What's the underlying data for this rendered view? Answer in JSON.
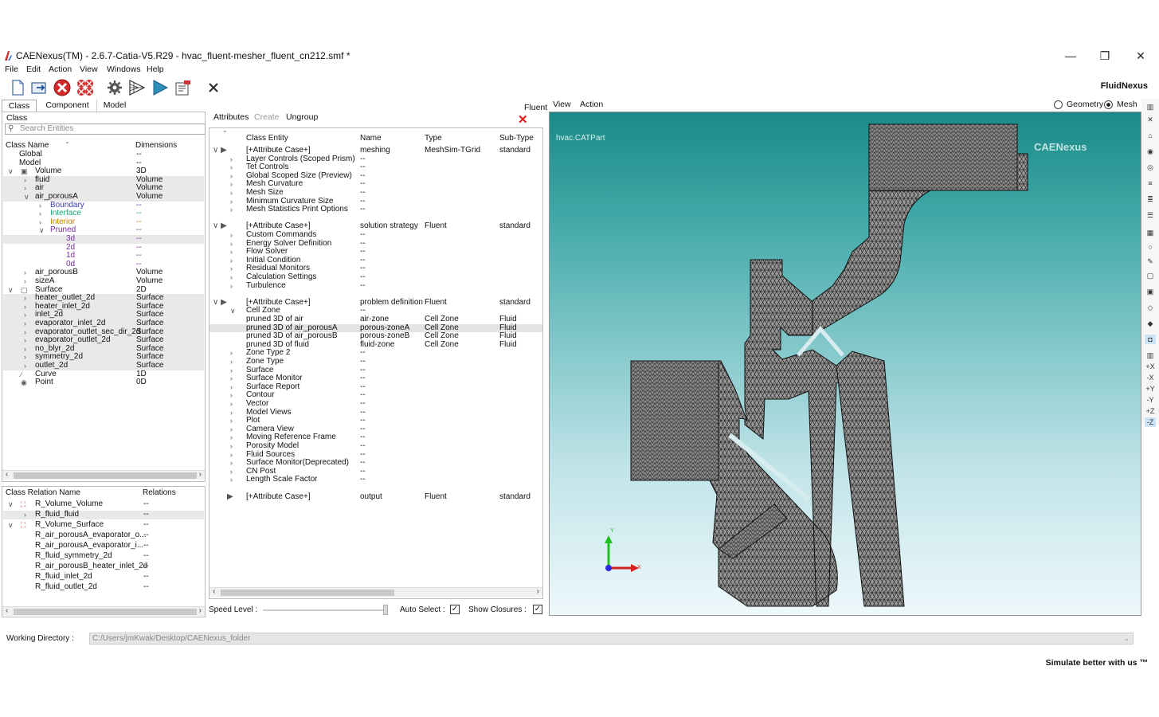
{
  "window": {
    "title": "CAENexus(TM) - 2.6.7-Catia-V5.R29 - hvac_fluent-mesher_fluent_cn212.smf  *",
    "minimize": "—",
    "restore": "❐",
    "close": "✕"
  },
  "menu": [
    "File",
    "Edit",
    "Action",
    "View",
    "Windows",
    "Help"
  ],
  "toolbar": {
    "brand": "FluidNexus"
  },
  "left_tabs": [
    "Class",
    "Component",
    "Model"
  ],
  "class_panel": {
    "section": "Class",
    "search_placeholder": "Search Entities",
    "col_name": "Class Name",
    "col_dim": "Dimensions",
    "rows": [
      {
        "chev": "",
        "name": "Global",
        "dim": "--",
        "indent": 20,
        "color": "#111",
        "shade": false
      },
      {
        "chev": "",
        "name": "Model",
        "dim": "--",
        "indent": 20,
        "color": "#111",
        "shade": false
      },
      {
        "chev": "∨",
        "name": "Volume",
        "dim": "3D",
        "indent": 40,
        "color": "#111",
        "shade": false,
        "icon": "cube"
      },
      {
        "chev": "›",
        "name": "fluid",
        "dim": "Volume",
        "indent": 40,
        "color": "#111",
        "shade": true
      },
      {
        "chev": "›",
        "name": "air",
        "dim": "Volume",
        "indent": 40,
        "color": "#111",
        "shade": true
      },
      {
        "chev": "∨",
        "name": "air_porousA",
        "dim": "Volume",
        "indent": 40,
        "color": "#111",
        "shade": true
      },
      {
        "chev": "›",
        "name": "Boundary",
        "dim": "--",
        "indent": 59,
        "color": "#3a3ab0",
        "shade": false
      },
      {
        "chev": "›",
        "name": "Interface",
        "dim": "--",
        "indent": 59,
        "color": "#1aa37a",
        "shade": false
      },
      {
        "chev": "›",
        "name": "Interior",
        "dim": "--",
        "indent": 59,
        "color": "#c87a00",
        "shade": false
      },
      {
        "chev": "∨",
        "name": "Pruned",
        "dim": "--",
        "indent": 59,
        "color": "#7a2aa0",
        "shade": false
      },
      {
        "chev": "",
        "name": "3d",
        "dim": "--",
        "indent": 79,
        "color": "#7a2aa0",
        "shade": true
      },
      {
        "chev": "",
        "name": "2d",
        "dim": "--",
        "indent": 79,
        "color": "#7a2aa0",
        "shade": false
      },
      {
        "chev": "",
        "name": "1d",
        "dim": "--",
        "indent": 79,
        "color": "#7a2aa0",
        "shade": false
      },
      {
        "chev": "",
        "name": "0d",
        "dim": "--",
        "indent": 79,
        "color": "#7a2aa0",
        "shade": false
      },
      {
        "chev": "›",
        "name": "air_porousB",
        "dim": "Volume",
        "indent": 40,
        "color": "#111",
        "shade": false
      },
      {
        "chev": "›",
        "name": "sizeA",
        "dim": "Volume",
        "indent": 40,
        "color": "#111",
        "shade": false
      },
      {
        "chev": "∨",
        "name": "Surface",
        "dim": "2D",
        "indent": 40,
        "color": "#111",
        "shade": false,
        "icon": "square"
      },
      {
        "chev": "›",
        "name": "heater_outlet_2d",
        "dim": "Surface",
        "indent": 40,
        "color": "#111",
        "shade": true
      },
      {
        "chev": "›",
        "name": "heater_inlet_2d",
        "dim": "Surface",
        "indent": 40,
        "color": "#111",
        "shade": true
      },
      {
        "chev": "›",
        "name": "inlet_2d",
        "dim": "Surface",
        "indent": 40,
        "color": "#111",
        "shade": true
      },
      {
        "chev": "›",
        "name": "evaporator_inlet_2d",
        "dim": "Surface",
        "indent": 40,
        "color": "#111",
        "shade": true
      },
      {
        "chev": "›",
        "name": "evaporator_outlet_sec_dir_2d",
        "dim": "Surface",
        "indent": 40,
        "color": "#111",
        "shade": true
      },
      {
        "chev": "›",
        "name": "evaporator_outlet_2d",
        "dim": "Surface",
        "indent": 40,
        "color": "#111",
        "shade": true
      },
      {
        "chev": "›",
        "name": "no_blyr_2d",
        "dim": "Surface",
        "indent": 40,
        "color": "#111",
        "shade": true
      },
      {
        "chev": "›",
        "name": "symmetry_2d",
        "dim": "Surface",
        "indent": 40,
        "color": "#111",
        "shade": true
      },
      {
        "chev": "›",
        "name": "outlet_2d",
        "dim": "Surface",
        "indent": 40,
        "color": "#111",
        "shade": true
      },
      {
        "chev": "",
        "name": "Curve",
        "dim": "1D",
        "indent": 40,
        "color": "#111",
        "shade": false,
        "icon": "curve"
      },
      {
        "chev": "",
        "name": "Point",
        "dim": "0D",
        "indent": 40,
        "color": "#111",
        "shade": false,
        "icon": "point"
      }
    ]
  },
  "relation_panel": {
    "col_name": "Class Relation Name",
    "col_rel": "Relations",
    "rows": [
      {
        "chev": "∨",
        "name": "R_Volume_Volume",
        "rel": "--",
        "indent": 40,
        "shade": false,
        "icon": true
      },
      {
        "chev": "›",
        "name": "R_fluid_fluid",
        "rel": "--",
        "indent": 40,
        "shade": true,
        "icon": false
      },
      {
        "chev": "∨",
        "name": "R_Volume_Surface",
        "rel": "--",
        "indent": 40,
        "shade": false,
        "icon": true
      },
      {
        "chev": "",
        "name": "R_air_porousA_evaporator_o...",
        "rel": "--",
        "indent": 40,
        "shade": false,
        "icon": false
      },
      {
        "chev": "",
        "name": "R_air_porousA_evaporator_i...",
        "rel": "--",
        "indent": 40,
        "shade": false,
        "icon": false
      },
      {
        "chev": "",
        "name": "R_fluid_symmetry_2d",
        "rel": "--",
        "indent": 40,
        "shade": false,
        "icon": false
      },
      {
        "chev": "",
        "name": "R_air_porousB_heater_inlet_2d",
        "rel": "--",
        "indent": 40,
        "shade": false,
        "icon": false
      },
      {
        "chev": "",
        "name": "R_fluid_inlet_2d",
        "rel": "--",
        "indent": 40,
        "shade": false,
        "icon": false
      },
      {
        "chev": "",
        "name": "R_fluid_outlet_2d",
        "rel": "--",
        "indent": 40,
        "shade": false,
        "icon": false
      }
    ]
  },
  "middle_panel": {
    "label_fluent": "Fluent",
    "tab_attributes": "Attributes",
    "tab_create": "Create",
    "tab_ungroup": "Ungroup",
    "close_glyph": "✕",
    "col_entity": "Class Entity",
    "col_name": "Name",
    "col_type": "Type",
    "col_sub": "Sub-Type",
    "rows": [
      {
        "chev": "∨ ▶",
        "entity": "[+Attribute Case+]",
        "name": "meshing",
        "type": "MeshSim-TGrid",
        "sub": "standard",
        "indent": 46,
        "shade": false
      },
      {
        "chev": "›",
        "entity": "Layer Controls (Scoped Prism)",
        "name": "--",
        "type": "",
        "sub": "",
        "indent": 46,
        "shade": false
      },
      {
        "chev": "›",
        "entity": "Tet Controls",
        "name": "--",
        "type": "",
        "sub": "",
        "indent": 46,
        "shade": false
      },
      {
        "chev": "›",
        "entity": "Global Scoped Size (Preview)",
        "name": "--",
        "type": "",
        "sub": "",
        "indent": 46,
        "shade": false
      },
      {
        "chev": "›",
        "entity": "Mesh Curvature",
        "name": "--",
        "type": "",
        "sub": "",
        "indent": 46,
        "shade": false
      },
      {
        "chev": "›",
        "entity": "Mesh Size",
        "name": "--",
        "type": "",
        "sub": "",
        "indent": 46,
        "shade": false
      },
      {
        "chev": "›",
        "entity": "Minimum Curvature Size",
        "name": "--",
        "type": "",
        "sub": "",
        "indent": 46,
        "shade": false
      },
      {
        "chev": "›",
        "entity": "Mesh Statistics Print Options",
        "name": "--",
        "type": "",
        "sub": "",
        "indent": 46,
        "shade": false
      },
      {
        "chev": "",
        "entity": "",
        "name": "",
        "type": "",
        "sub": "",
        "indent": 46,
        "shade": false
      },
      {
        "chev": "∨ ▶",
        "entity": "[+Attribute Case+]",
        "name": "solution strategy",
        "type": "Fluent",
        "sub": "standard",
        "indent": 46,
        "shade": false
      },
      {
        "chev": "›",
        "entity": "Custom Commands",
        "name": "--",
        "type": "",
        "sub": "",
        "indent": 46,
        "shade": false
      },
      {
        "chev": "›",
        "entity": "Energy Solver Definition",
        "name": "--",
        "type": "",
        "sub": "",
        "indent": 46,
        "shade": false
      },
      {
        "chev": "›",
        "entity": "Flow Solver",
        "name": "--",
        "type": "",
        "sub": "",
        "indent": 46,
        "shade": false
      },
      {
        "chev": "›",
        "entity": "Initial Condition",
        "name": "--",
        "type": "",
        "sub": "",
        "indent": 46,
        "shade": false
      },
      {
        "chev": "›",
        "entity": "Residual Monitors",
        "name": "--",
        "type": "",
        "sub": "",
        "indent": 46,
        "shade": false
      },
      {
        "chev": "›",
        "entity": "Calculation Settings",
        "name": "--",
        "type": "",
        "sub": "",
        "indent": 46,
        "shade": false
      },
      {
        "chev": "›",
        "entity": "Turbulence",
        "name": "--",
        "type": "",
        "sub": "",
        "indent": 46,
        "shade": false
      },
      {
        "chev": "",
        "entity": "",
        "name": "",
        "type": "",
        "sub": "",
        "indent": 46,
        "shade": false
      },
      {
        "chev": "∨ ▶",
        "entity": "[+Attribute Case+]",
        "name": "problem definition",
        "type": "Fluent",
        "sub": "standard",
        "indent": 46,
        "shade": false
      },
      {
        "chev": "∨",
        "entity": "Cell Zone",
        "name": "--",
        "type": "",
        "sub": "",
        "indent": 46,
        "shade": false
      },
      {
        "chev": "",
        "entity": "pruned 3D of air",
        "name": "air-zone",
        "type": "Cell Zone",
        "sub": "Fluid",
        "indent": 46,
        "shade": false
      },
      {
        "chev": "",
        "entity": "pruned 3D of air_porousA",
        "name": "porous-zoneA",
        "type": "Cell Zone",
        "sub": "Fluid",
        "indent": 46,
        "shade": true
      },
      {
        "chev": "",
        "entity": "pruned 3D of air_porousB",
        "name": "porous-zoneB",
        "type": "Cell Zone",
        "sub": "Fluid",
        "indent": 46,
        "shade": false
      },
      {
        "chev": "",
        "entity": "pruned 3D of fluid",
        "name": "fluid-zone",
        "type": "Cell Zone",
        "sub": "Fluid",
        "indent": 46,
        "shade": false
      },
      {
        "chev": "›",
        "entity": "Zone Type 2",
        "name": "--",
        "type": "",
        "sub": "",
        "indent": 46,
        "shade": false
      },
      {
        "chev": "›",
        "entity": "Zone Type",
        "name": "--",
        "type": "",
        "sub": "",
        "indent": 46,
        "shade": false
      },
      {
        "chev": "›",
        "entity": "Surface",
        "name": "--",
        "type": "",
        "sub": "",
        "indent": 46,
        "shade": false
      },
      {
        "chev": "›",
        "entity": "Surface Monitor",
        "name": "--",
        "type": "",
        "sub": "",
        "indent": 46,
        "shade": false
      },
      {
        "chev": "›",
        "entity": "Surface Report",
        "name": "--",
        "type": "",
        "sub": "",
        "indent": 46,
        "shade": false
      },
      {
        "chev": "›",
        "entity": "Contour",
        "name": "--",
        "type": "",
        "sub": "",
        "indent": 46,
        "shade": false
      },
      {
        "chev": "›",
        "entity": "Vector",
        "name": "--",
        "type": "",
        "sub": "",
        "indent": 46,
        "shade": false
      },
      {
        "chev": "›",
        "entity": "Model Views",
        "name": "--",
        "type": "",
        "sub": "",
        "indent": 46,
        "shade": false
      },
      {
        "chev": "›",
        "entity": "Plot",
        "name": "--",
        "type": "",
        "sub": "",
        "indent": 46,
        "shade": false
      },
      {
        "chev": "›",
        "entity": "Camera View",
        "name": "--",
        "type": "",
        "sub": "",
        "indent": 46,
        "shade": false
      },
      {
        "chev": "›",
        "entity": "Moving Reference Frame",
        "name": "--",
        "type": "",
        "sub": "",
        "indent": 46,
        "shade": false
      },
      {
        "chev": "›",
        "entity": "Porosity Model",
        "name": "--",
        "type": "",
        "sub": "",
        "indent": 46,
        "shade": false
      },
      {
        "chev": "›",
        "entity": "Fluid Sources",
        "name": "--",
        "type": "",
        "sub": "",
        "indent": 46,
        "shade": false
      },
      {
        "chev": "›",
        "entity": "Surface Monitor(Deprecated)",
        "name": "--",
        "type": "",
        "sub": "",
        "indent": 46,
        "shade": false
      },
      {
        "chev": "›",
        "entity": "CN Post",
        "name": "--",
        "type": "",
        "sub": "",
        "indent": 46,
        "shade": false
      },
      {
        "chev": "›",
        "entity": "Length Scale Factor",
        "name": "--",
        "type": "",
        "sub": "",
        "indent": 46,
        "shade": false
      },
      {
        "chev": "",
        "entity": "",
        "name": "",
        "type": "",
        "sub": "",
        "indent": 46,
        "shade": false
      },
      {
        "chev": "▶",
        "entity": "[+Attribute Case+]",
        "name": "output",
        "type": "Fluent",
        "sub": "standard",
        "indent": 46,
        "shade": false
      }
    ]
  },
  "speedbar": {
    "speed_label": "Speed Level :",
    "auto_select": "Auto Select :",
    "show_closures": "Show Closures :"
  },
  "viewport": {
    "menu_view": "View",
    "menu_action": "Action",
    "radio_geometry": "Geometry",
    "radio_mesh": "Mesh",
    "part_label": "hvac.CATPart",
    "watermark": "CAENexus",
    "axis_y": "Y",
    "axis_x": "X",
    "colors": {
      "mesh": "#3a3a3a",
      "bg_top": "#1a8a88",
      "bg_bottom": "#eef8fb"
    }
  },
  "right_toolbar": [
    "+X",
    "-X",
    "+Y",
    "-Y",
    "+Z",
    "-Z"
  ],
  "footer": {
    "workdir_label": "Working Directory :",
    "workdir_value": "C:/Users/jmKwak/Desktop/CAENexus_folder",
    "slogan": "Simulate better with us ™"
  }
}
